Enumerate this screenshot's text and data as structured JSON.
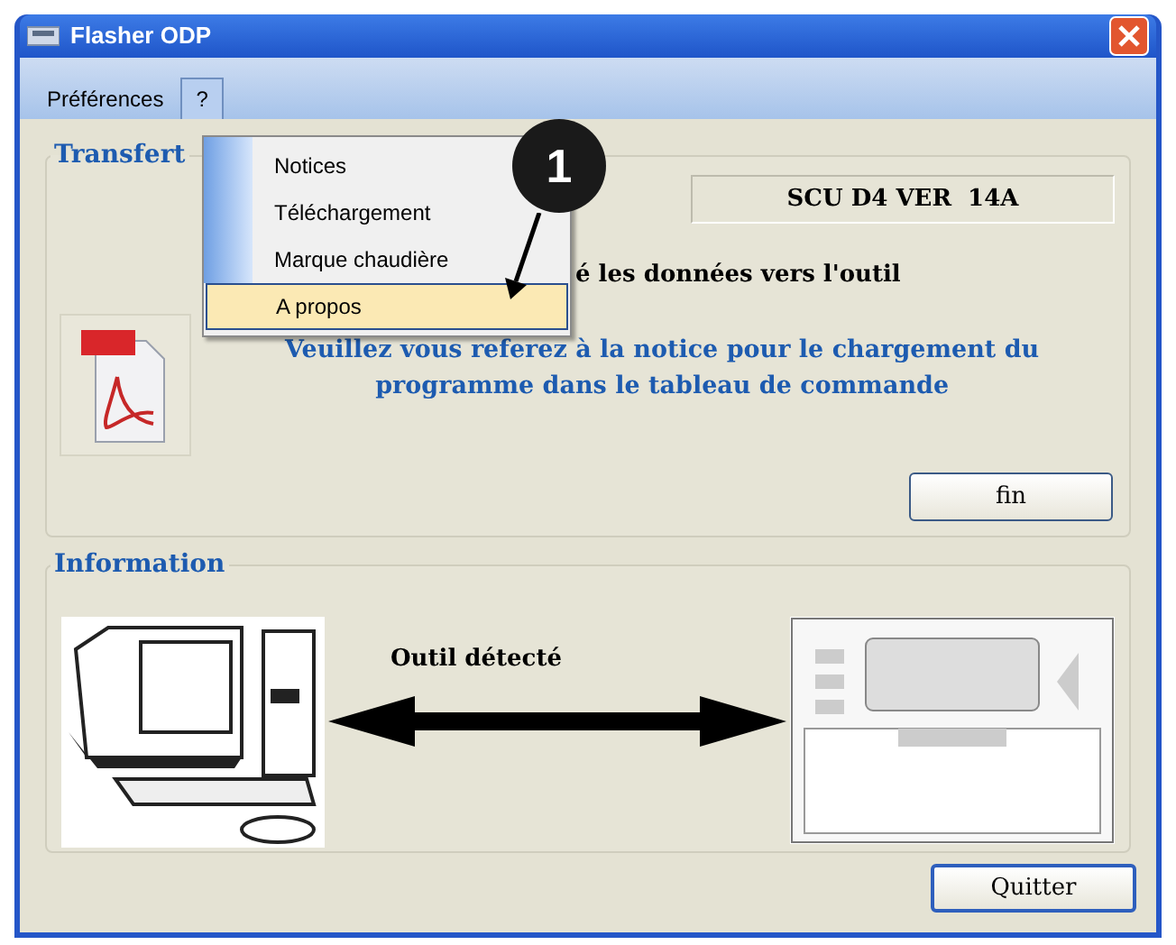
{
  "window": {
    "title": "Flasher ODP"
  },
  "menu_bar": [
    {
      "label": "Préférences",
      "selected": false
    },
    {
      "label": "?",
      "selected": true
    }
  ],
  "dropdown": [
    {
      "label": "Notices",
      "selected": false
    },
    {
      "label": "Téléchargement",
      "selected": false
    },
    {
      "label": "Marque chaudière",
      "selected": false
    },
    {
      "label": "A propos",
      "selected": true
    }
  ],
  "callout": {
    "number": "1"
  },
  "transfert": {
    "title": "Transfert",
    "version": "SCU D4 VER  14A",
    "status": "é les données vers l'outil",
    "notice": "Veuillez vous referez à la notice pour le chargement du programme dans le tableau de commande",
    "button": "fin"
  },
  "information": {
    "title": "Information",
    "status": "Outil détecté"
  },
  "button": "Quitter"
}
